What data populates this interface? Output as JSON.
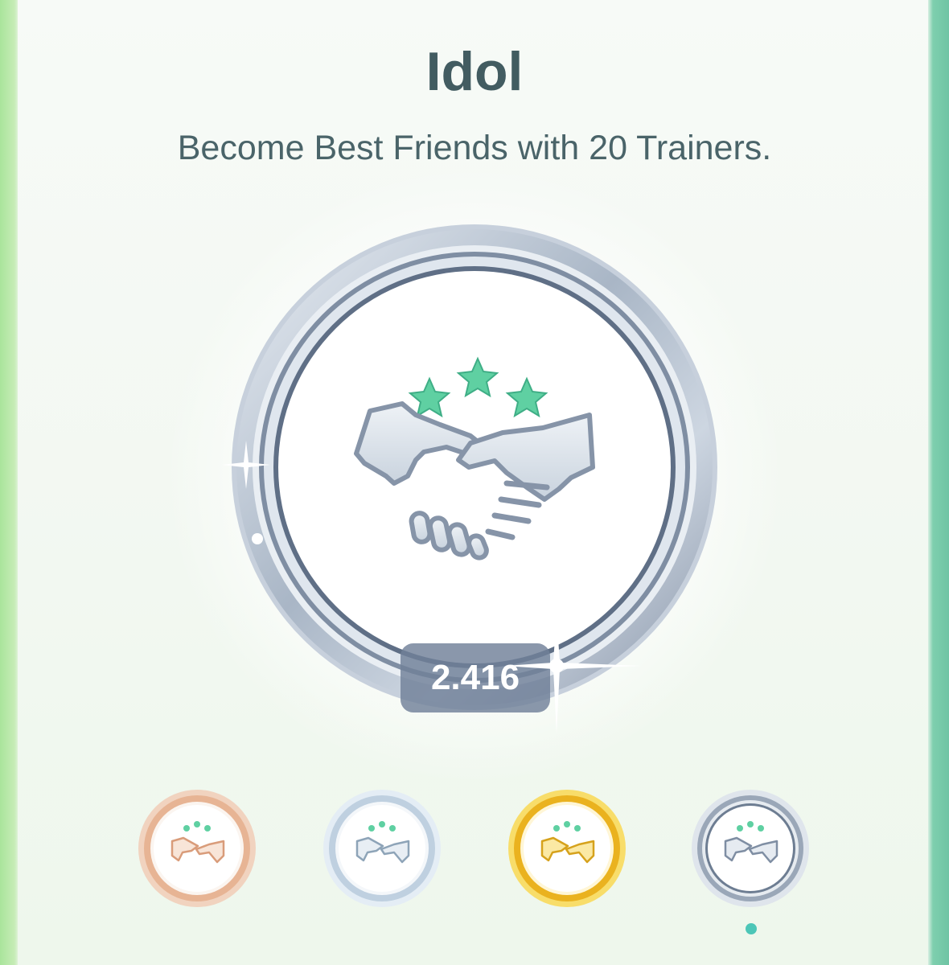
{
  "badge": {
    "title": "Idol",
    "description": "Become Best Friends with 20 Trainers.",
    "progress_count": "2.416",
    "current_tier": "platinum",
    "icon": "handshake-with-three-stars-icon"
  },
  "tiers": [
    {
      "name": "bronze",
      "icon": "handshake-icon",
      "ring_color": "#ecc2a6"
    },
    {
      "name": "silver",
      "icon": "handshake-icon",
      "ring_color": "#c9d8e6"
    },
    {
      "name": "gold",
      "icon": "handshake-icon",
      "ring_color": "#f2c234"
    },
    {
      "name": "platinum",
      "icon": "handshake-icon",
      "ring_color": "#aab4c2",
      "selected": true
    }
  ],
  "colors": {
    "title": "#425c61",
    "star": "#5fd0a2",
    "counter_bg": "#708098",
    "selected_dot": "#4cc6b7"
  }
}
